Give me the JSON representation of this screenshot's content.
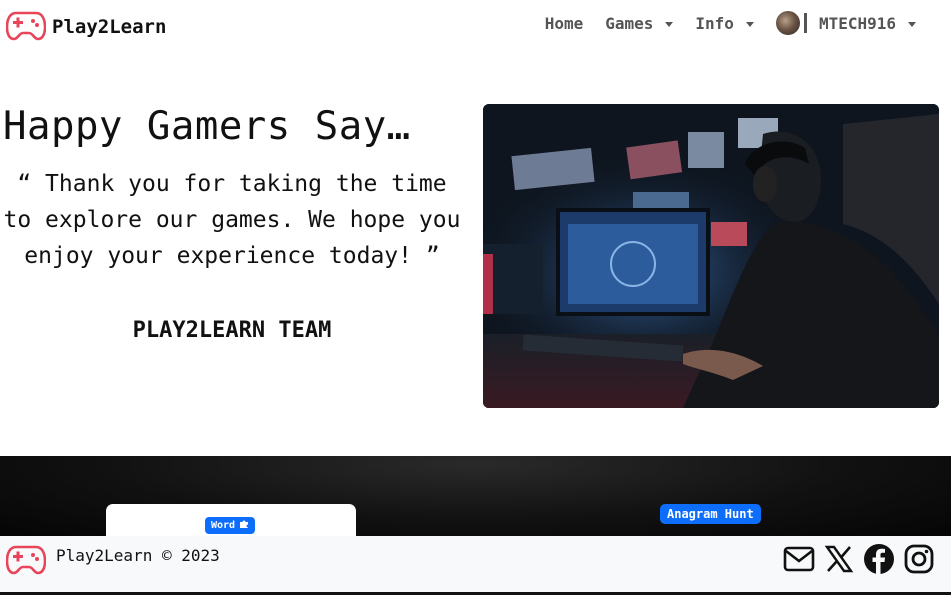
{
  "navbar": {
    "brand": "Play2Learn",
    "links": {
      "home": "Home",
      "games": "Games",
      "info": "Info",
      "user": "MTECH916"
    }
  },
  "hero": {
    "title": "Happy Gamers Say…",
    "quote": "“ Thank you for taking the time to explore our games. We hope you enjoy your experience today! ”",
    "signature": "PLAY2LEARN TEAM"
  },
  "games_section": {
    "word_badge": "Word",
    "anagram_badge": "Anagram Hunt"
  },
  "footer": {
    "copyright": "Play2Learn © 2023",
    "social_icons": [
      "envelope-icon",
      "x-twitter-icon",
      "facebook-icon",
      "instagram-icon"
    ]
  },
  "colors": {
    "brand_red": "#e8455a",
    "badge_blue": "#0d6efd",
    "nav_gray": "#555555",
    "footer_bg": "#f8f9fa"
  }
}
